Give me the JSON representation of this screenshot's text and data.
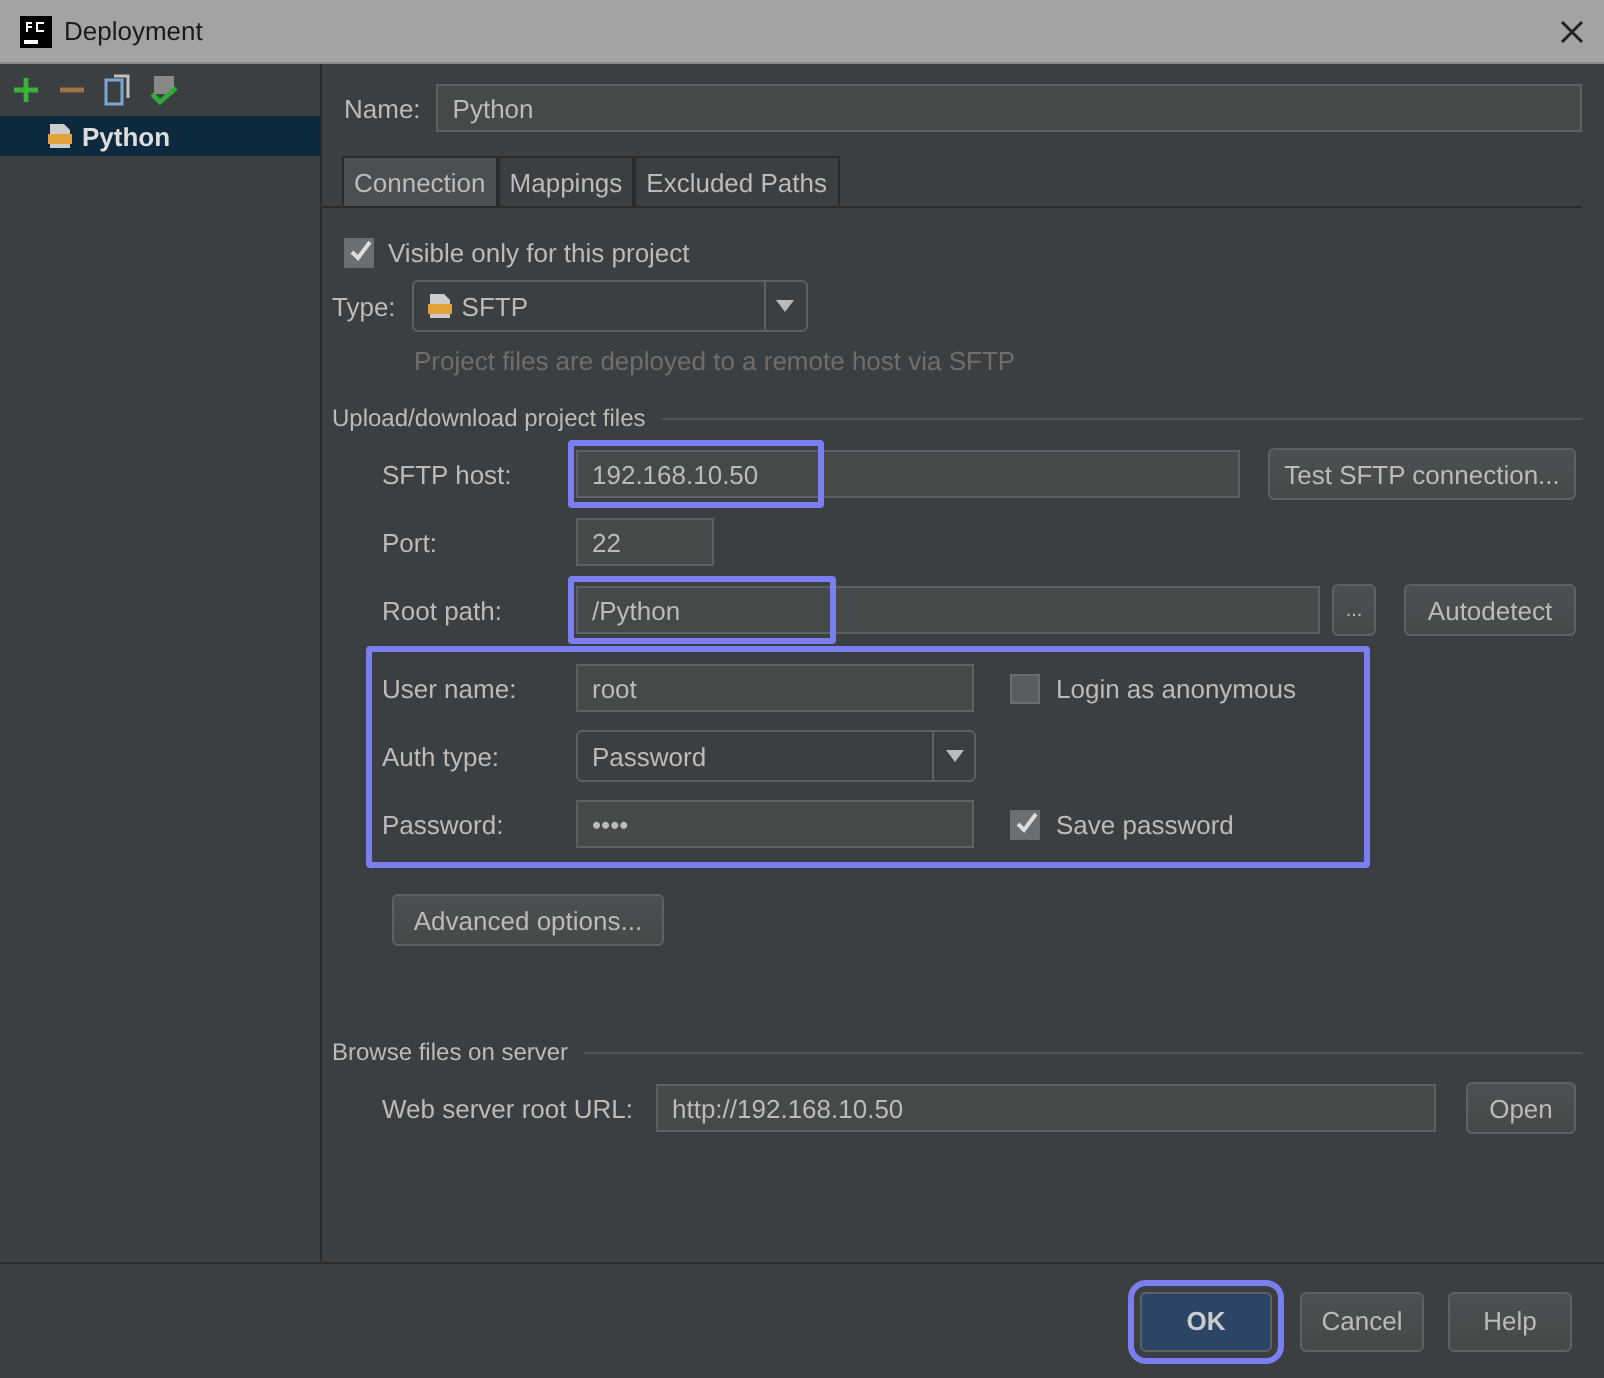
{
  "window": {
    "title": "Deployment"
  },
  "sidebar": {
    "items": [
      {
        "label": "Python",
        "selected": true
      }
    ]
  },
  "name": {
    "label": "Name:",
    "value": "Python"
  },
  "tabs": [
    {
      "label": "Connection",
      "selected": true
    },
    {
      "label": "Mappings",
      "selected": false
    },
    {
      "label": "Excluded Paths",
      "selected": false
    }
  ],
  "visible_only": {
    "label": "Visible only for this project",
    "checked": true
  },
  "type": {
    "label": "Type:",
    "value": "SFTP",
    "hint": "Project files are deployed to a remote host via SFTP"
  },
  "upload_section": {
    "title": "Upload/download project files",
    "host": {
      "label": "SFTP host:",
      "value": "192.168.10.50",
      "highlighted": true,
      "button": "Test SFTP connection..."
    },
    "port": {
      "label": "Port:",
      "value": "22"
    },
    "root_path": {
      "label": "Root path:",
      "value": "/Python",
      "highlighted": true,
      "browse": "...",
      "button": "Autodetect"
    },
    "credentials": {
      "highlighted": true,
      "user": {
        "label": "User name:",
        "value": "root",
        "checkbox": "Login as anonymous",
        "checked": false
      },
      "auth": {
        "label": "Auth type:",
        "value": "Password"
      },
      "password": {
        "label": "Password:",
        "value": "••••",
        "checkbox": "Save password",
        "checked": true
      }
    },
    "advanced_button": "Advanced options..."
  },
  "browse_section": {
    "title": "Browse files on server",
    "url": {
      "label": "Web server root URL:",
      "value": "http://192.168.10.50",
      "button": "Open"
    }
  },
  "buttons": [
    {
      "label": "OK",
      "highlighted": true
    },
    {
      "label": "Cancel",
      "highlighted": false
    },
    {
      "label": "Help",
      "highlighted": false
    }
  ]
}
